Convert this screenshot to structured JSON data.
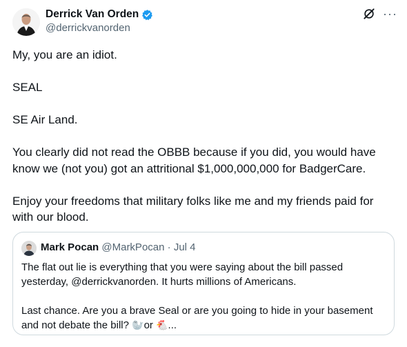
{
  "author": {
    "display_name": "Derrick Van Orden",
    "handle": "@derrickvanorden",
    "verified": true,
    "verified_color": "#1d9bf0"
  },
  "icons": {
    "verified": "verified-badge-icon",
    "grok": "grok-icon",
    "more": "more-icon"
  },
  "more_glyph": "···",
  "tweet": {
    "paragraphs": [
      "My, you are an idiot.",
      "SEAL",
      "SE Air Land.",
      "You clearly did not read the OBBB because if you did, you would have know we (not you) got an attritional $1,000,000,000 for BadgerCare.",
      "Enjoy your freedoms that military folks like me and my friends paid for with our blood."
    ]
  },
  "quote": {
    "display_name": "Mark Pocan",
    "handle": "@MarkPocan",
    "separator": "·",
    "date": "Jul 4",
    "paragraph1": "The flat out lie is everything that you were saying about the bill passed yesterday, @derrickvanorden. It hurts millions of Americans.",
    "paragraph2_text": "Last chance. Are you a brave Seal or are you going to hide in your basement and not debate the bill?",
    "emoji_seal": "🦭",
    "or_word": "or",
    "emoji_chicken": "🐔",
    "ellipsis": "..."
  }
}
